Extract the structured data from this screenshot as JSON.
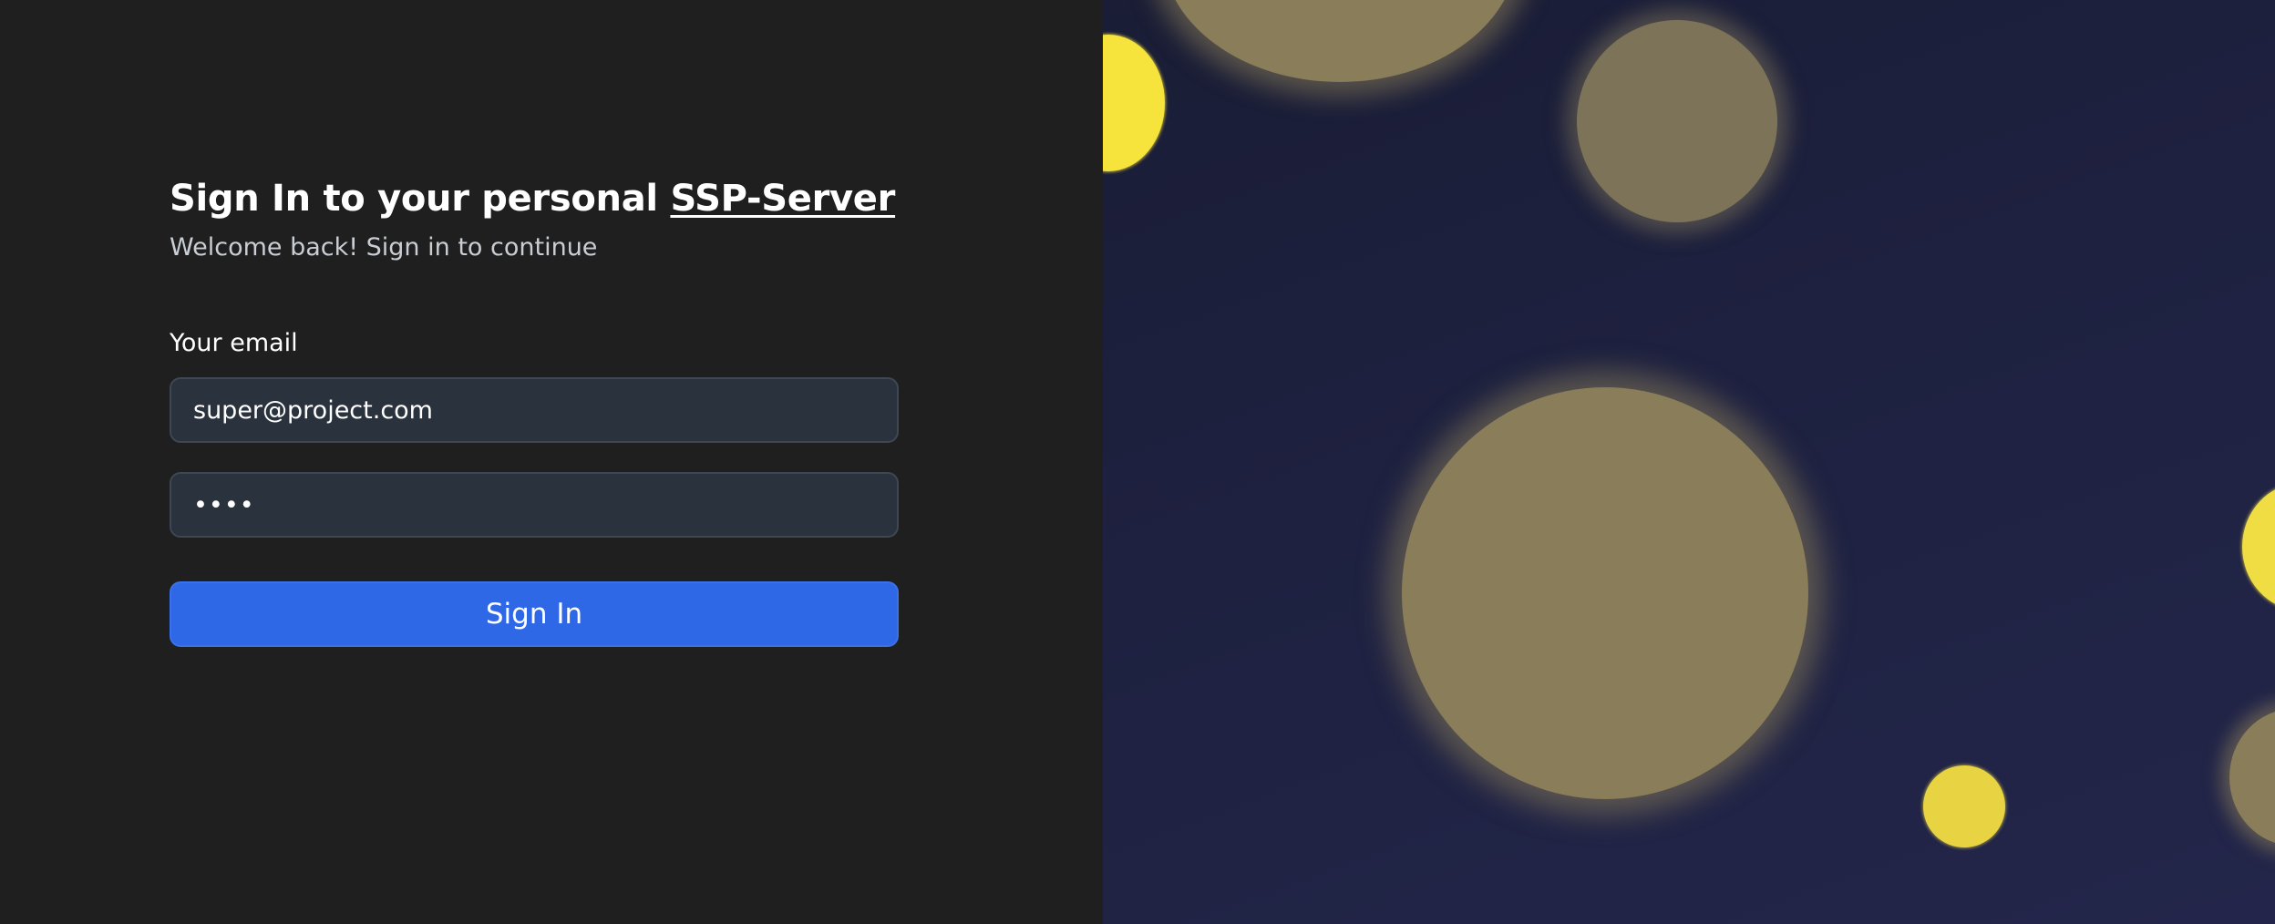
{
  "signin": {
    "heading_prefix": "Sign In to your personal ",
    "heading_link": "SSP-Server",
    "subtitle": "Welcome back! Sign in to continue",
    "email_label": "Your email",
    "email_value": "super@project.com",
    "password_value": "••••",
    "button_label": "Sign In"
  },
  "colors": {
    "left_background": "#1f1f1f",
    "input_background": "#2a323d",
    "button_blue": "#2f68e6",
    "right_background": "#1e2140",
    "bokeh_yellow": "#f6e33c",
    "bokeh_muted": "#8a7d5a"
  }
}
